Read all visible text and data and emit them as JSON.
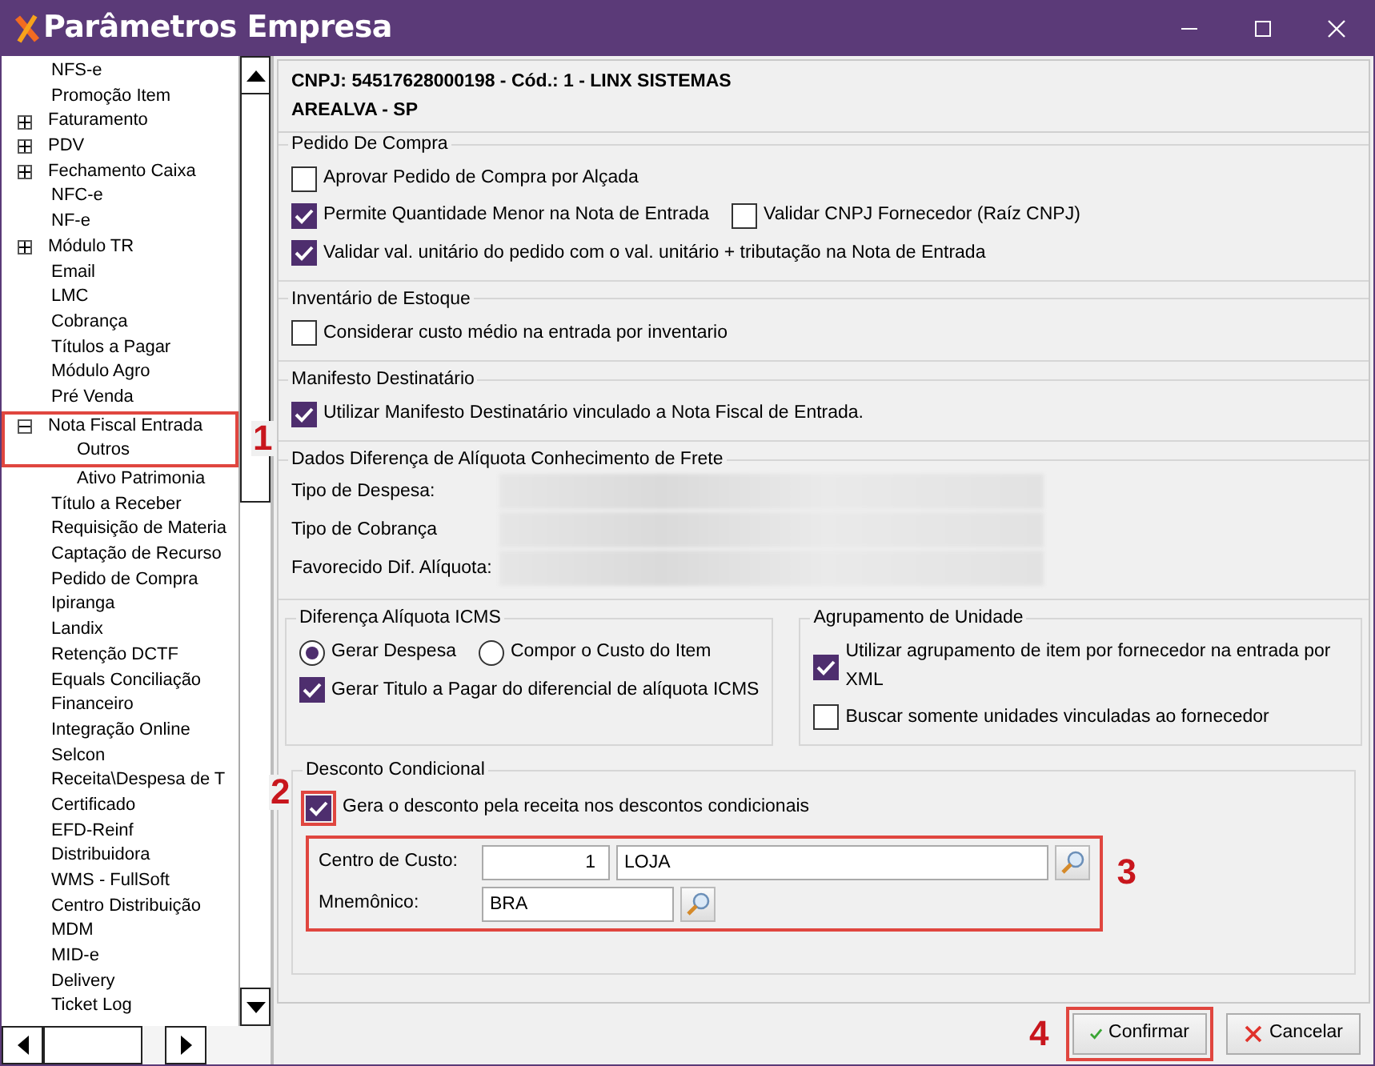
{
  "window": {
    "title": "Parâmetros Empresa"
  },
  "sidebar": {
    "items": [
      {
        "label": "NFS-e"
      },
      {
        "label": "Promoção Item"
      },
      {
        "label": "Faturamento",
        "expanded": false
      },
      {
        "label": "PDV",
        "expanded": false
      },
      {
        "label": "Fechamento Caixa",
        "expanded": false
      },
      {
        "label": "NFC-e"
      },
      {
        "label": "NF-e"
      },
      {
        "label": "Módulo TR",
        "expanded": false
      },
      {
        "label": "Email"
      },
      {
        "label": "LMC"
      },
      {
        "label": "Cobrança"
      },
      {
        "label": "Títulos a Pagar"
      },
      {
        "label": "Módulo Agro"
      },
      {
        "label": "Pré Venda"
      },
      {
        "label": "Nota Fiscal Entrada",
        "expanded": true,
        "highlighted": true,
        "callout": "1",
        "children": [
          {
            "label": "Outros",
            "highlighted": true
          },
          {
            "label": "Ativo Patrimonia"
          }
        ]
      },
      {
        "label": "Título a Receber"
      },
      {
        "label": "Requisição de Materia"
      },
      {
        "label": "Captação de Recurso"
      },
      {
        "label": "Pedido de Compra"
      },
      {
        "label": "Ipiranga"
      },
      {
        "label": "Landix"
      },
      {
        "label": "Retenção DCTF"
      },
      {
        "label": "Equals Conciliação"
      },
      {
        "label": "Financeiro"
      },
      {
        "label": "Integração Online"
      },
      {
        "label": "Selcon"
      },
      {
        "label": "Receita\\Despesa de T"
      },
      {
        "label": "Certificado"
      },
      {
        "label": "EFD-Reinf"
      },
      {
        "label": "Distribuidora"
      },
      {
        "label": "WMS - FullSoft"
      },
      {
        "label": "Centro Distribuição"
      },
      {
        "label": "MDM"
      },
      {
        "label": "MID-e"
      },
      {
        "label": "Delivery"
      },
      {
        "label": "Ticket Log"
      }
    ]
  },
  "header": {
    "company": "CNPJ: 54517628000198 - Cód.: 1 - LINX SISTEMAS",
    "city": "AREALVA - SP"
  },
  "sections": [
    {
      "kind": "group",
      "title": "Pedido De Compra",
      "rows": [
        [
          {
            "kind": "checkbox",
            "label": "Aprovar Pedido de Compra por Alçada",
            "checked": false
          }
        ],
        [
          {
            "kind": "checkbox",
            "label": "Permite Quantidade Menor na Nota de Entrada",
            "checked": true
          },
          {
            "kind": "checkbox",
            "label": "Validar CNPJ Fornecedor (Raíz CNPJ)",
            "checked": false
          }
        ],
        [
          {
            "kind": "checkbox",
            "label": "Validar val. unitário do pedido com o val. unitário + tributação na Nota de Entrada",
            "checked": true
          }
        ]
      ]
    },
    {
      "kind": "group",
      "title": "Inventário de Estoque",
      "rows": [
        [
          {
            "kind": "checkbox",
            "label": "Considerar custo médio na entrada por inventario",
            "checked": false
          }
        ]
      ]
    },
    {
      "kind": "group",
      "title": "Manifesto Destinatário",
      "rows": [
        [
          {
            "kind": "checkbox",
            "label": "Utilizar Manifesto Destinatário vinculado a Nota Fiscal de Entrada.",
            "checked": true
          }
        ]
      ]
    },
    {
      "kind": "group",
      "title": "Dados Diferença de Alíquota Conhecimento de Frete",
      "rows": [
        [
          {
            "kind": "blurred",
            "label": "Tipo de Despesa:"
          }
        ],
        [
          {
            "kind": "blurred",
            "label": "Tipo de Cobrança"
          }
        ],
        [
          {
            "kind": "blurred",
            "label": "Favorecido Dif. Alíquota:"
          }
        ]
      ]
    },
    {
      "kind": "pair",
      "groups": [
        {
          "title": "Diferença Alíquota ICMS",
          "rows": [
            [
              {
                "kind": "radio",
                "label": "Gerar Despesa",
                "selected": true
              },
              {
                "kind": "radio",
                "label": "Compor o Custo do Item",
                "selected": false
              }
            ],
            [
              {
                "kind": "checkbox",
                "label": "Gerar Titulo a Pagar do diferencial de alíquota ICMS",
                "checked": true
              }
            ]
          ]
        },
        {
          "title": "Agrupamento de Unidade",
          "rows": [
            [
              {
                "kind": "checkbox",
                "label": "Utilizar agrupamento de item por fornecedor na entrada por XML",
                "checked": true
              }
            ],
            [
              {
                "kind": "checkbox",
                "label": "Buscar somente unidades vinculadas ao fornecedor",
                "checked": false
              }
            ]
          ]
        }
      ]
    },
    {
      "kind": "group",
      "title": "Desconto Condicional",
      "rows": [
        [
          {
            "kind": "checkbox",
            "label": "Gera o desconto pela receita nos descontos condicionais",
            "checked": true,
            "callout": "2"
          }
        ],
        [
          {
            "kind": "fields",
            "callout": "3",
            "lines": [
              {
                "label": "Centro de Custo:",
                "inputs": [
                  {
                    "value": "1"
                  },
                  {
                    "value": "LOJA"
                  }
                ],
                "lookup": true
              },
              {
                "label": "Mnemônico:",
                "inputs": [
                  {
                    "value": "BRA"
                  }
                ],
                "lookup": true
              }
            ]
          }
        ]
      ]
    }
  ],
  "buttons": [
    {
      "label": "Confirmar",
      "callout": "4"
    },
    {
      "label": "Cancelar"
    }
  ]
}
